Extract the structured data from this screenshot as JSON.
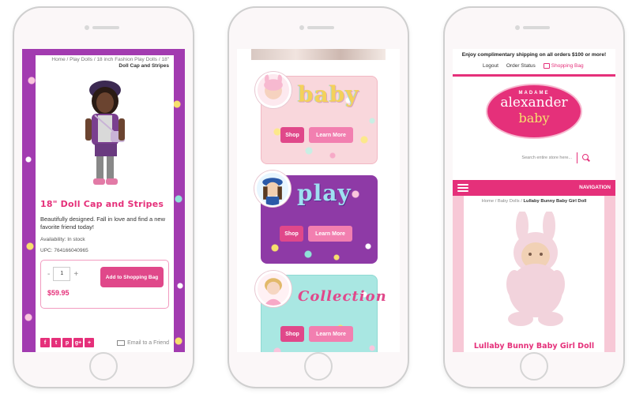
{
  "phone1": {
    "breadcrumb": {
      "prefix": "Home / Play Dolls / 18 inch Fashion Play Dolls / 18\"",
      "current": "Doll Cap and Stripes"
    },
    "product_title": "18\" Doll Cap and Stripes",
    "description": "Beautifully designed. Fall in love and find a new favorite friend today!",
    "availability": "Availability: In stock",
    "upc": "UPC: 764166040965",
    "qty_minus": "-",
    "qty_value": "1",
    "qty_plus": "+",
    "price": "$59.95",
    "add_button": "Add to Shopping Bag",
    "share_icons": [
      "f",
      "t",
      "p",
      "g+",
      "+"
    ],
    "email_friend": "Email to a Friend"
  },
  "phone2": {
    "cards": [
      {
        "title": "baby",
        "shop": "Shop",
        "learn": "Learn More"
      },
      {
        "title": "play",
        "shop": "Shop",
        "learn": "Learn More"
      },
      {
        "title": "Collection",
        "shop": "Shop",
        "learn": "Learn More"
      }
    ]
  },
  "phone3": {
    "promo": "Enjoy complimentary shipping on all orders $100 or more!",
    "links": {
      "logout": "Logout",
      "order_status": "Order Status",
      "bag": "Shopping Bag"
    },
    "logo": {
      "line1": "MADAME",
      "line2": "alexander",
      "line3": "baby"
    },
    "search_placeholder": "Search entire store here...",
    "nav_label": "NAVIGATION",
    "breadcrumb": {
      "prefix": "Home / Baby Dolls /",
      "current": "Lullaby Bunny Baby Girl Doll"
    },
    "product_title": "Lullaby Bunny Baby Girl Doll"
  },
  "colors": {
    "brand_pink": "#e5307a",
    "purple": "#a23bb0",
    "mint": "#a9e7e2"
  }
}
